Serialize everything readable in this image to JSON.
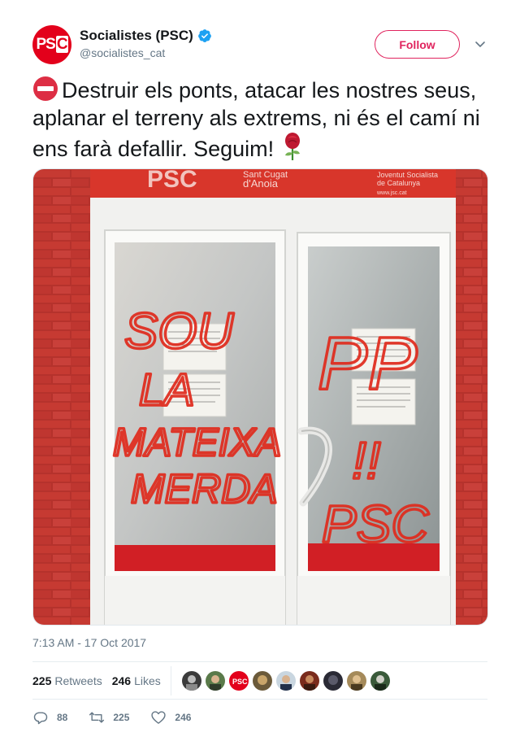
{
  "author": {
    "display_name": "Socialistes (PSC)",
    "handle": "@socialistes_cat",
    "avatar_text_main": "PS",
    "avatar_text_accent": "C"
  },
  "follow_label": "Follow",
  "tweet": {
    "text": "Destruir els ponts, atacar les nostres seus, aplanar el terreny als extrems, ni és el camí ni ens farà defallir. Seguim!",
    "leading_icon": "no-entry-icon",
    "trailing_icon": "rose-icon"
  },
  "photo": {
    "sign_left": "PSC",
    "sign_mid_line1": "Sant Cugat",
    "sign_mid_line2": "d'Anoia",
    "sign_right_line1": "Joventut Socialista",
    "sign_right_line2": "de Catalunya",
    "sign_right_line3": "www.jsc.cat",
    "graffiti_left": [
      "SOU",
      "LA",
      "MATEIXA",
      "MERDA"
    ],
    "graffiti_right": [
      "PP",
      "!!",
      "PSC"
    ]
  },
  "timestamp": "7:13 AM - 17 Oct 2017",
  "stats": {
    "retweets_count": "225",
    "retweets_label": "Retweets",
    "likes_count": "246",
    "likes_label": "Likes"
  },
  "actions": {
    "reply_count": "88",
    "retweet_count": "225",
    "like_count": "246"
  },
  "colors": {
    "brand_red": "#e3001b",
    "follow_pink": "#e0245e",
    "muted": "#657786"
  }
}
